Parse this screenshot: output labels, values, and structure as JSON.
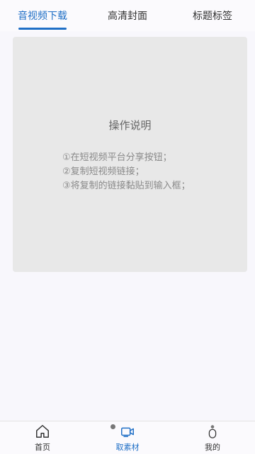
{
  "tabs": [
    {
      "label": "音视频下载",
      "active": true
    },
    {
      "label": "高清封面",
      "active": false
    },
    {
      "label": "标题标签",
      "active": false
    }
  ],
  "panel": {
    "title": "操作说明",
    "steps": [
      "①在短视频平台分享按钮；",
      "②复制短视频链接；",
      "③将复制的链接黏贴到输入框；"
    ]
  },
  "bottom_nav": [
    {
      "label": "首页",
      "icon": "home-icon",
      "active": false
    },
    {
      "label": "取素材",
      "icon": "video-camera-icon",
      "active": true
    },
    {
      "label": "我的",
      "icon": "user-icon",
      "active": false
    }
  ],
  "colors": {
    "accent": "#1f6fc6",
    "background": "#f8f7fc",
    "panel": "#e8e8e8"
  }
}
